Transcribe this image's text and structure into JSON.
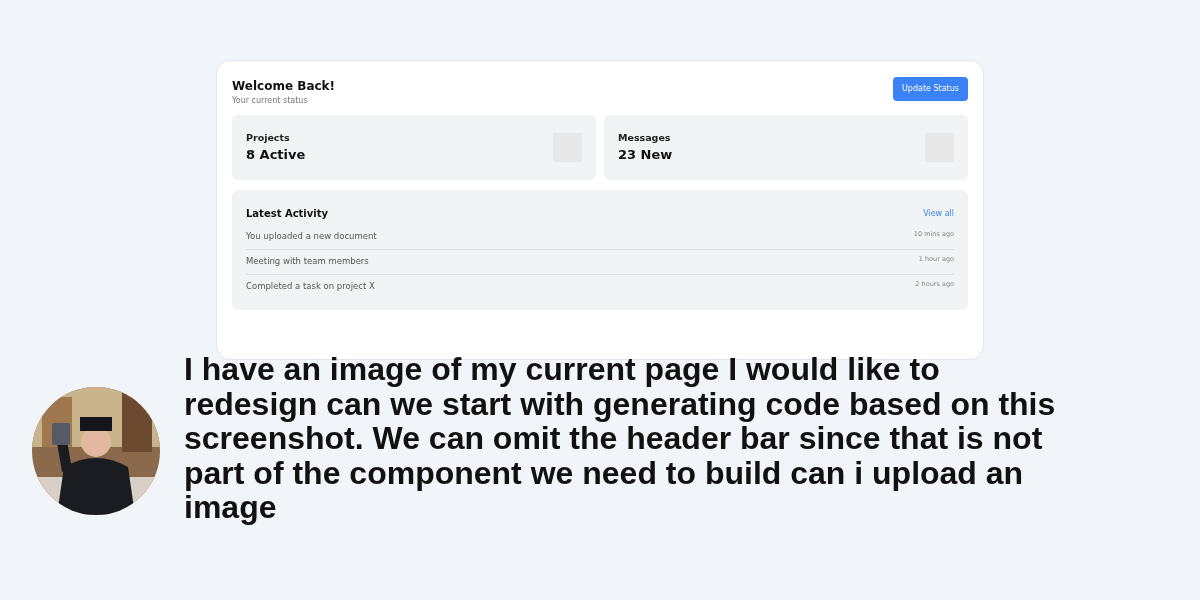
{
  "card": {
    "title": "Welcome Back!",
    "subtitle": "Your current status",
    "button": "Update Status",
    "stats": [
      {
        "label": "Projects",
        "value": "8 Active"
      },
      {
        "label": "Messages",
        "value": "23 New"
      }
    ],
    "activity": {
      "title": "Latest Activity",
      "link": "View all",
      "items": [
        {
          "text": "You uploaded a new document",
          "time": "10 mins ago"
        },
        {
          "text": "Meeting with team members",
          "time": "1 hour ago"
        },
        {
          "text": "Completed a task on project X",
          "time": "2 hours ago"
        }
      ]
    }
  },
  "message": {
    "text": "I have an image of my current page I would like to redesign can we start with generating code based on this screenshot. We can omit the header bar since that is not part of the component we need to build can i upload an image"
  }
}
